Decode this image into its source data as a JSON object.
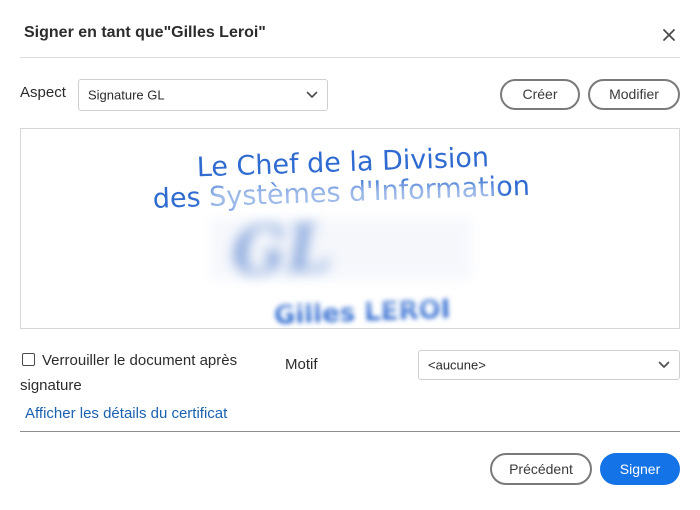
{
  "dialog": {
    "title": "Signer en tant que\"Gilles Leroi\""
  },
  "aspect": {
    "label": "Aspect",
    "selected": "Signature GL",
    "create_label": "Créer",
    "modify_label": "Modifier"
  },
  "signature_preview": {
    "line1": "Le Chef de la Division",
    "line2": "des Systèmes d'Information",
    "initials": "GL",
    "name": "Gilles LEROI",
    "color": "#2f6bd0"
  },
  "options": {
    "lock_label_line1": "Verrouiller le document après",
    "lock_label_line2": "signature",
    "lock_checked": false,
    "motif_label": "Motif",
    "motif_selected": "<aucune>",
    "cert_link": "Afficher les détails du certificat"
  },
  "footer": {
    "previous_label": "Précédent",
    "sign_label": "Signer",
    "sign_color": "#1473e6"
  }
}
